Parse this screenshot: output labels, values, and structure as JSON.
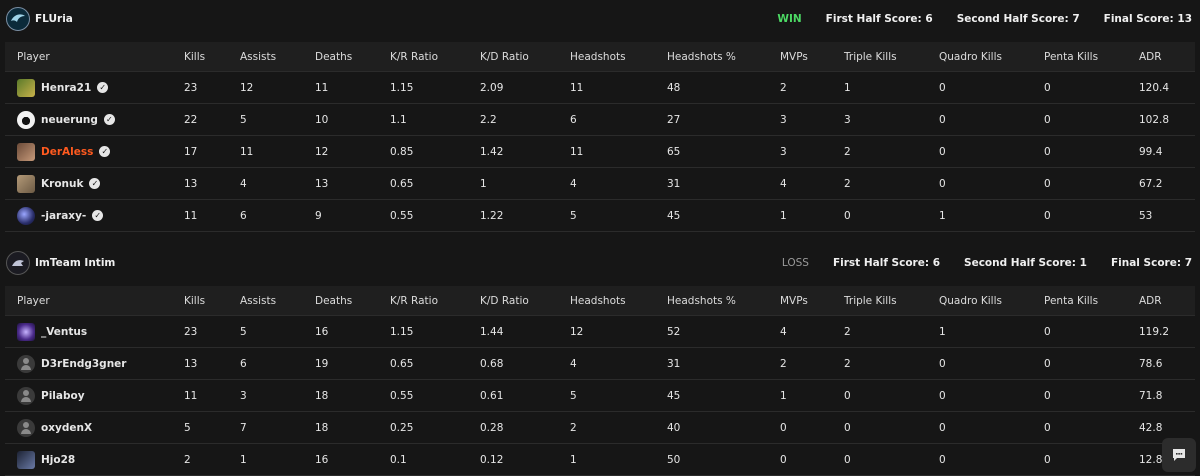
{
  "headers": [
    "Player",
    "Kills",
    "Assists",
    "Deaths",
    "K/R Ratio",
    "K/D Ratio",
    "Headshots",
    "Headshots %",
    "MVPs",
    "Triple Kills",
    "Quadro Kills",
    "Penta Kills",
    "ADR"
  ],
  "teams": [
    {
      "name": "FLUria",
      "result": "WIN",
      "first_half": "First Half Score: 6",
      "second_half": "Second Half Score: 7",
      "final": "Final Score: 13",
      "players": [
        {
          "name": "Henra21",
          "verified": true,
          "avatar": "green",
          "stats": [
            "23",
            "12",
            "11",
            "1.15",
            "2.09",
            "11",
            "48",
            "2",
            "1",
            "0",
            "0",
            "120.4"
          ]
        },
        {
          "name": "neuerung",
          "verified": true,
          "avatar": "panda",
          "stats": [
            "22",
            "5",
            "10",
            "1.1",
            "2.2",
            "6",
            "27",
            "3",
            "3",
            "0",
            "0",
            "102.8"
          ]
        },
        {
          "name": "DerAless",
          "verified": true,
          "highlight": true,
          "avatar": "brown",
          "stats": [
            "17",
            "11",
            "12",
            "0.85",
            "1.42",
            "11",
            "65",
            "3",
            "2",
            "0",
            "0",
            "99.4"
          ]
        },
        {
          "name": "Kronuk",
          "verified": true,
          "avatar": "tan",
          "stats": [
            "13",
            "4",
            "13",
            "0.65",
            "1",
            "4",
            "31",
            "4",
            "2",
            "0",
            "0",
            "67.2"
          ]
        },
        {
          "name": "-jaraxy-",
          "verified": true,
          "avatar": "space",
          "stats": [
            "11",
            "6",
            "9",
            "0.55",
            "1.22",
            "5",
            "45",
            "1",
            "0",
            "1",
            "0",
            "53"
          ]
        }
      ]
    },
    {
      "name": "ImTeam Intim",
      "result": "LOSS",
      "first_half": "First Half Score: 6",
      "second_half": "Second Half Score: 1",
      "final": "Final Score: 7",
      "players": [
        {
          "name": "_Ventus",
          "verified": false,
          "avatar": "purple",
          "stats": [
            "23",
            "5",
            "16",
            "1.15",
            "1.44",
            "12",
            "52",
            "4",
            "2",
            "1",
            "0",
            "119.2"
          ]
        },
        {
          "name": "D3rEndg3gner",
          "verified": false,
          "avatar": "default",
          "stats": [
            "13",
            "6",
            "19",
            "0.65",
            "0.68",
            "4",
            "31",
            "2",
            "2",
            "0",
            "0",
            "78.6"
          ]
        },
        {
          "name": "Pilaboy",
          "verified": false,
          "avatar": "default",
          "stats": [
            "11",
            "3",
            "18",
            "0.55",
            "0.61",
            "5",
            "45",
            "1",
            "0",
            "0",
            "0",
            "71.8"
          ]
        },
        {
          "name": "oxydenX",
          "verified": false,
          "avatar": "default",
          "stats": [
            "5",
            "7",
            "18",
            "0.25",
            "0.28",
            "2",
            "40",
            "0",
            "0",
            "0",
            "0",
            "42.8"
          ]
        },
        {
          "name": "Hjo28",
          "verified": false,
          "avatar": "dark",
          "stats": [
            "2",
            "1",
            "16",
            "0.1",
            "0.12",
            "1",
            "50",
            "0",
            "0",
            "0",
            "0",
            "12.8"
          ]
        }
      ]
    }
  ],
  "icons": {
    "verified": "verified-check-icon",
    "chat": "chat-icon"
  },
  "colors": {
    "win": "#4cd964",
    "highlight": "#ff5a1f",
    "background": "#161616"
  }
}
